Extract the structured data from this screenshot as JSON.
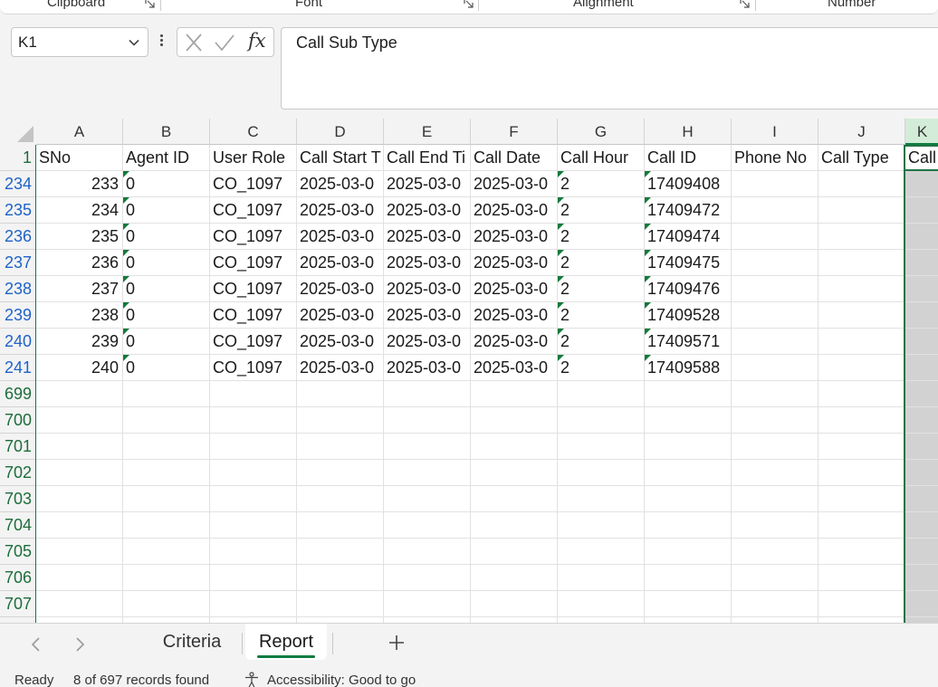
{
  "ribbon": {
    "groups": [
      {
        "label": "Clipboard"
      },
      {
        "label": "Font"
      },
      {
        "label": "Alignment"
      },
      {
        "label": "Number"
      }
    ]
  },
  "formula_bar": {
    "name_box": "K1",
    "formula": "Call Sub Type",
    "icons": [
      "cancel-icon",
      "enter-icon",
      "insert-function-icon"
    ]
  },
  "grid": {
    "columns": [
      "A",
      "B",
      "C",
      "D",
      "E",
      "F",
      "G",
      "H",
      "I",
      "J",
      "K"
    ],
    "selected_column": "K",
    "header_row_number": "1",
    "headers": [
      "SNo",
      "Agent ID",
      "User Role",
      "Call Start T",
      "Call End Ti",
      "Call Date",
      "Call Hour",
      "Call ID",
      "Phone No",
      "Call Type",
      "Call"
    ],
    "rows": [
      {
        "row": "234",
        "cells": [
          "233",
          "0",
          "CO_1097",
          "2025-03-0",
          "2025-03-0",
          "2025-03-0",
          "2",
          "17409408",
          "",
          "",
          ""
        ]
      },
      {
        "row": "235",
        "cells": [
          "234",
          "0",
          "CO_1097",
          "2025-03-0",
          "2025-03-0",
          "2025-03-0",
          "2",
          "17409472",
          "",
          "",
          ""
        ]
      },
      {
        "row": "236",
        "cells": [
          "235",
          "0",
          "CO_1097",
          "2025-03-0",
          "2025-03-0",
          "2025-03-0",
          "2",
          "17409474",
          "",
          "",
          ""
        ]
      },
      {
        "row": "237",
        "cells": [
          "236",
          "0",
          "CO_1097",
          "2025-03-0",
          "2025-03-0",
          "2025-03-0",
          "2",
          "17409475",
          "",
          "",
          ""
        ]
      },
      {
        "row": "238",
        "cells": [
          "237",
          "0",
          "CO_1097",
          "2025-03-0",
          "2025-03-0",
          "2025-03-0",
          "2",
          "17409476",
          "",
          "",
          ""
        ]
      },
      {
        "row": "239",
        "cells": [
          "238",
          "0",
          "CO_1097",
          "2025-03-0",
          "2025-03-0",
          "2025-03-0",
          "2",
          "17409528",
          "",
          "",
          ""
        ]
      },
      {
        "row": "240",
        "cells": [
          "239",
          "0",
          "CO_1097",
          "2025-03-0",
          "2025-03-0",
          "2025-03-0",
          "2",
          "17409571",
          "",
          "",
          ""
        ]
      },
      {
        "row": "241",
        "cells": [
          "240",
          "0",
          "CO_1097",
          "2025-03-0",
          "2025-03-0",
          "2025-03-0",
          "2",
          "17409588",
          "",
          "",
          ""
        ]
      }
    ],
    "empty_rows": [
      "699",
      "700",
      "701",
      "702",
      "703",
      "704",
      "705",
      "706",
      "707"
    ]
  },
  "sheet_tabs": {
    "tabs": [
      {
        "label": "Criteria",
        "active": false
      },
      {
        "label": "Report",
        "active": true
      }
    ],
    "add_sheet": "+"
  },
  "status_bar": {
    "ready": "Ready",
    "records": "8 of 697 records found",
    "accessibility": "Accessibility: Good to go"
  },
  "colors": {
    "excel_green": "#107c41",
    "filtered_row_number": "#1e63c8",
    "selected_column_fill": "#d2d2d2"
  }
}
